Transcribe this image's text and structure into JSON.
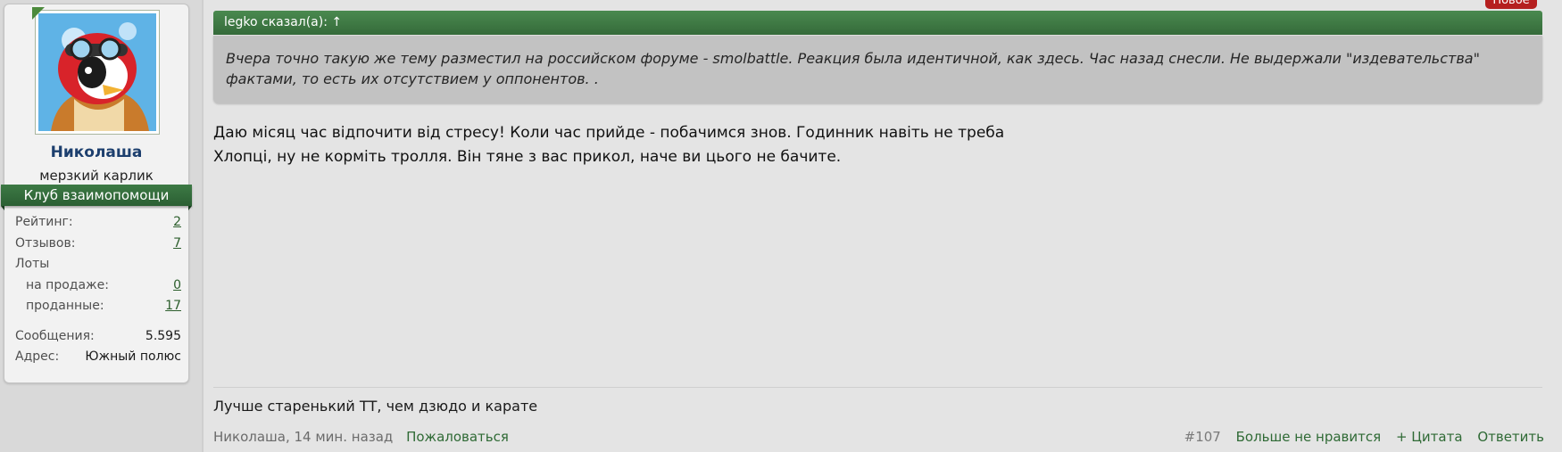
{
  "user": {
    "name": "Николаша",
    "title": "мерзкий карлик",
    "group": "Клуб взаимопомощи",
    "stats": [
      {
        "label": "Рейтинг:",
        "value": "2",
        "link": true
      },
      {
        "label": "Отзывов:",
        "value": "7",
        "link": true
      },
      {
        "label": "Лоты",
        "value": "",
        "link": false
      },
      {
        "label": "на продаже:",
        "value": "0",
        "link": true,
        "indent": true
      },
      {
        "label": "проданные:",
        "value": "17",
        "link": true,
        "indent": true
      }
    ],
    "extra": [
      {
        "label": "Сообщения:",
        "value": "5.595"
      },
      {
        "label": "Адрес:",
        "value": "Южный полюс"
      }
    ]
  },
  "post": {
    "badge": "Новое",
    "quote": {
      "header": "legko сказал(а): ↑",
      "text": "Вчера точно такую же тему разместил на российском форуме - smolbattle. Реакция была идентичной, как здесь. Час назад снесли. Не выдержали \"издевательства\" фактами, то есть их отсутствием у оппонентов. ."
    },
    "lines": [
      "Даю місяц час відпочити від стресу! Коли час прийде - побачимся знов. Годинник навіть не треба",
      "Хлопці, ну не корміть тролля. Він тяне з вас прикол, наче ви цього не бачите."
    ],
    "signature": "Лучше старенький ТТ, чем дзюдо и карате",
    "meta": {
      "author_time": "Николаша, 14 мин. назад",
      "report": "Пожаловаться"
    },
    "actions": {
      "number": "#107",
      "unlike": "Больше не нравится",
      "quote": "+ Цитата",
      "reply": "Ответить"
    }
  },
  "colors": {
    "accent_green": "#356a3a",
    "badge_red": "#b51f1f",
    "username_blue": "#1d3f6e"
  }
}
